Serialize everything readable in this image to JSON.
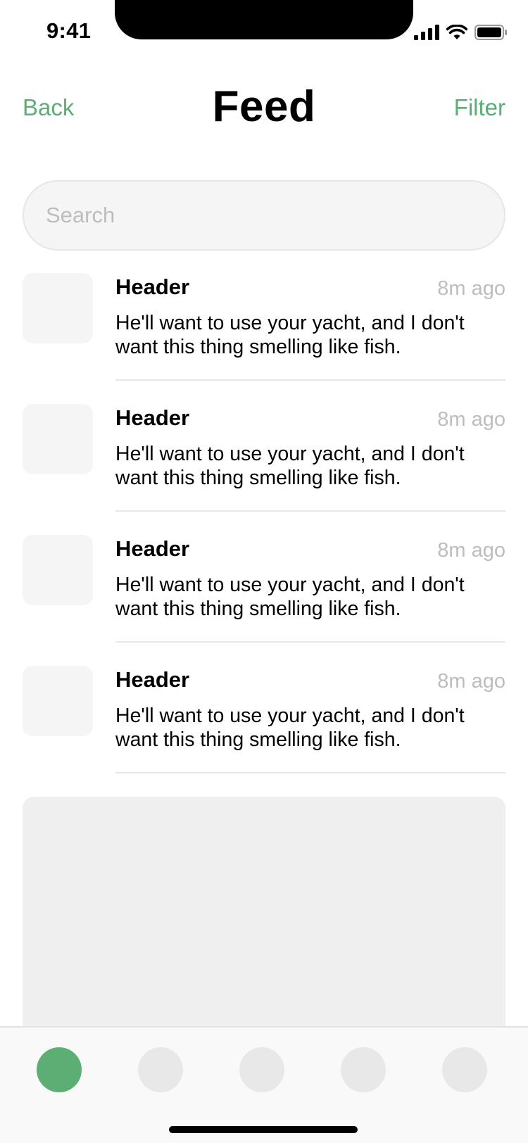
{
  "status_bar": {
    "time": "9:41",
    "icons": [
      "cellular-signal-icon",
      "wifi-icon",
      "battery-icon"
    ]
  },
  "nav": {
    "back_label": "Back",
    "title": "Feed",
    "filter_label": "Filter"
  },
  "search": {
    "placeholder": "Search",
    "value": ""
  },
  "feed": {
    "items": [
      {
        "header": "Header",
        "time": "8m ago",
        "body": "He'll want to use your yacht, and I don't want this thing smelling like fish."
      },
      {
        "header": "Header",
        "time": "8m ago",
        "body": "He'll want to use your yacht, and I don't want this thing smelling like fish."
      },
      {
        "header": "Header",
        "time": "8m ago",
        "body": "He'll want to use your yacht, and I don't want this thing smelling like fish."
      },
      {
        "header": "Header",
        "time": "8m ago",
        "body": "He'll want to use your yacht, and I don't want this thing smelling like fish."
      }
    ]
  },
  "tab_bar": {
    "tabs": [
      "tab-1",
      "tab-2",
      "tab-3",
      "tab-4",
      "tab-5"
    ],
    "active_index": 0
  },
  "colors": {
    "accent": "#5cae75",
    "placeholder": "#bdbdbd",
    "surface": "#f5f5f5",
    "card": "#efefef",
    "divider": "#e8e8e8"
  }
}
